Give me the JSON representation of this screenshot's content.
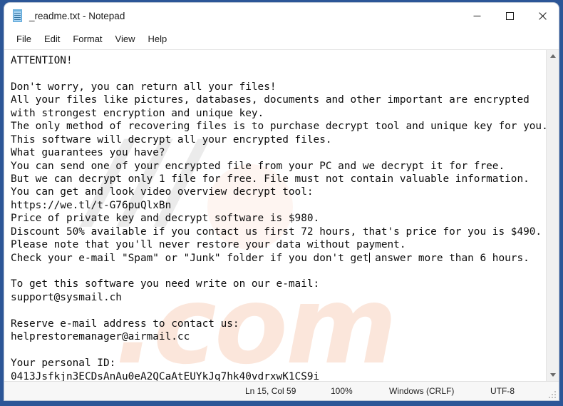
{
  "window": {
    "title": "_readme.txt - Notepad",
    "app_icon": "notepad-icon",
    "controls": {
      "minimize": "—",
      "maximize": "☐",
      "close": "✕"
    }
  },
  "menu": {
    "items": [
      {
        "label": "File"
      },
      {
        "label": "Edit"
      },
      {
        "label": "Format"
      },
      {
        "label": "View"
      },
      {
        "label": "Help"
      }
    ]
  },
  "document": {
    "filename": "_readme.txt",
    "lines": [
      "ATTENTION!",
      "",
      "Don't worry, you can return all your files!",
      "All your files like pictures, databases, documents and other important are encrypted",
      "with strongest encryption and unique key.",
      "The only method of recovering files is to purchase decrypt tool and unique key for you.",
      "This software will decrypt all your encrypted files.",
      "What guarantees you have?",
      "You can send one of your encrypted file from your PC and we decrypt it for free.",
      "But we can decrypt only 1 file for free. File must not contain valuable information.",
      "You can get and look video overview decrypt tool:",
      "https://we.tl/t-G76puQlxBn",
      "Price of private key and decrypt software is $980.",
      "Discount 50% available if you contact us first 72 hours, that's price for you is $490.",
      "Please note that you'll never restore your data without payment.",
      "Check your e-mail \"Spam\" or \"Junk\" folder if you don't get answer more than 6 hours.",
      "",
      "To get this software you need write on our e-mail:",
      "support@sysmail.ch",
      "",
      "Reserve e-mail address to contact us:",
      "helprestoremanager@airmail.cc",
      "",
      "Your personal ID:",
      "0413Jsfkjn3ECDsAnAu0eA2QCaAtEUYkJq7hk40vdrxwK1CS9i"
    ],
    "caret_line_index": 15,
    "caret_after_text": "Check your e-mail \"Spam\" or \"Junk\" folder if you don't get",
    "caret_rest_text": " answer more than 6 hours.",
    "download_url": "https://we.tl/t-G76puQlxBn",
    "primary_email": "support@sysmail.ch",
    "reserve_email": "helprestoremanager@airmail.cc",
    "personal_id": "0413Jsfkjn3ECDsAnAu0eA2QCaAtEUYkJq7hk40vdrxwK1CS9i",
    "price_full": "$980",
    "price_discount": "$490",
    "discount_percent": "50%",
    "discount_window_hours": "72",
    "reply_window_hours": "6"
  },
  "scrollbar": {
    "up_arrow": "scroll-up",
    "down_arrow": "scroll-down"
  },
  "statusbar": {
    "cursor_position": "Ln 15, Col 59",
    "zoom": "100%",
    "line_ending": "Windows (CRLF)",
    "encoding": "UTF-8"
  },
  "watermark": {
    "text_1": "///",
    "text_2": ".com"
  },
  "colors": {
    "desktop_blue": "#2c5697",
    "window_bg": "#ffffff",
    "text": "#0d0d0d",
    "statusbar_bg": "#f7f7f7",
    "scrollbar_bg": "#f0f0f0"
  }
}
